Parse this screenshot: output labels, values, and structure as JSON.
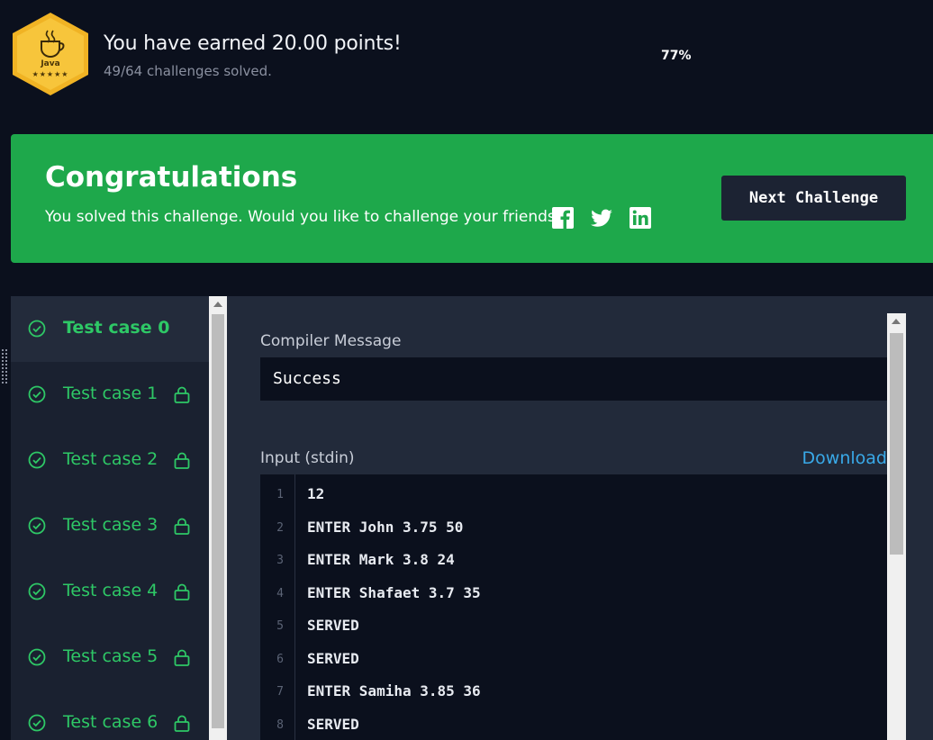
{
  "header": {
    "badge_language": "Java",
    "badge_stars": "★★★★★",
    "points_text": "You have earned 20.00 points!",
    "solved_text": "49/64 challenges solved.",
    "progress_percent": "77%"
  },
  "banner": {
    "title": "Congratulations",
    "message": "You solved this challenge. Would you like to challenge your friends?",
    "social_icons": [
      "facebook-icon",
      "twitter-icon",
      "linkedin-icon"
    ],
    "next_button": "Next Challenge",
    "background_color": "#1ea84b"
  },
  "tests": {
    "items": [
      {
        "label": "Test case 0",
        "locked": false,
        "active": true
      },
      {
        "label": "Test case 1",
        "locked": true,
        "active": false
      },
      {
        "label": "Test case 2",
        "locked": true,
        "active": false
      },
      {
        "label": "Test case 3",
        "locked": true,
        "active": false
      },
      {
        "label": "Test case 4",
        "locked": true,
        "active": false
      },
      {
        "label": "Test case 5",
        "locked": true,
        "active": false
      },
      {
        "label": "Test case 6",
        "locked": true,
        "active": false
      }
    ],
    "status_color": "#2ec866"
  },
  "panel": {
    "compiler_label": "Compiler Message",
    "compiler_message": "Success",
    "input_label": "Input (stdin)",
    "download_label": "Download",
    "input_lines": [
      {
        "n": "1",
        "text": "12"
      },
      {
        "n": "2",
        "text": "ENTER John 3.75 50"
      },
      {
        "n": "3",
        "text": "ENTER Mark 3.8 24"
      },
      {
        "n": "4",
        "text": "ENTER Shafaet 3.7 35"
      },
      {
        "n": "5",
        "text": "SERVED"
      },
      {
        "n": "6",
        "text": "SERVED"
      },
      {
        "n": "7",
        "text": "ENTER Samiha 3.85 36"
      },
      {
        "n": "8",
        "text": "SERVED"
      }
    ],
    "link_color": "#39a9e8"
  }
}
